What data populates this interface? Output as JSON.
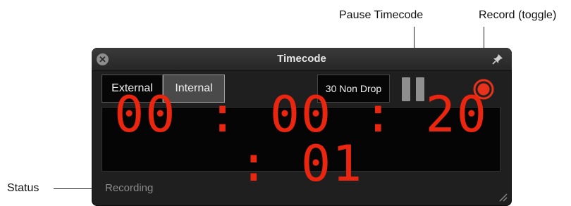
{
  "annotations": {
    "pause_timecode": "Pause Timecode",
    "record_toggle": "Record (toggle)",
    "status": "Status"
  },
  "window": {
    "title": "Timecode",
    "icons": {
      "close": "close-icon",
      "pin": "pin-icon",
      "resize": "resize-grip-icon"
    }
  },
  "source": {
    "options": [
      "External",
      "Internal"
    ],
    "selected": "Internal"
  },
  "frame_rate": "30 Non Drop",
  "controls": {
    "pause_icon": "pause-icon",
    "record_icon": "record-icon"
  },
  "timecode": {
    "display": "00:00:20:01",
    "color": "#ea2510"
  },
  "status_text": "Recording",
  "colors": {
    "record": "#e8321b",
    "window_bg": "#1f1f1f"
  }
}
